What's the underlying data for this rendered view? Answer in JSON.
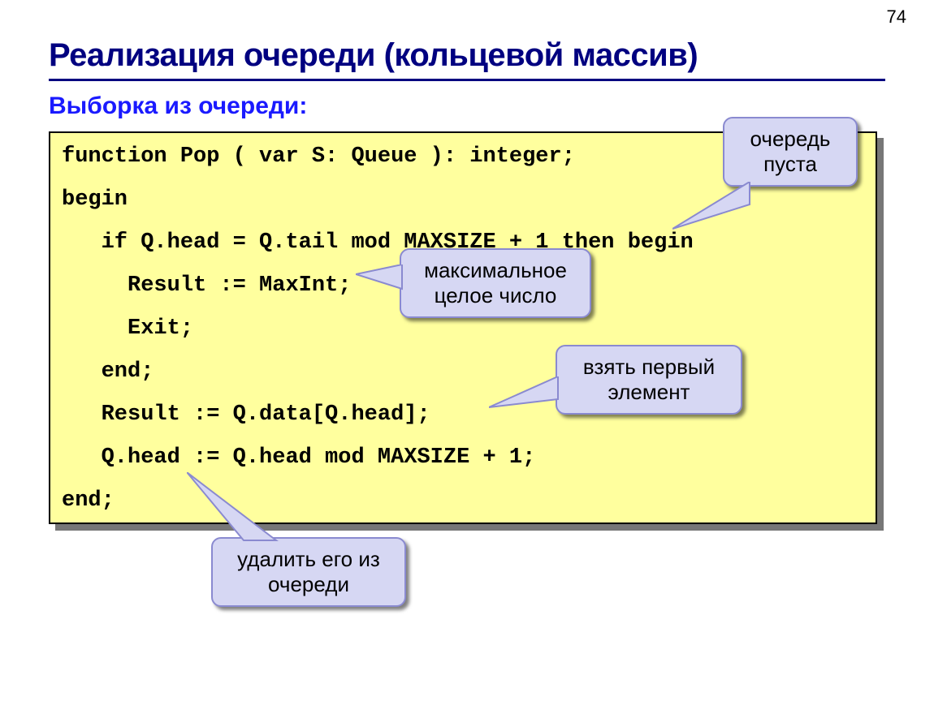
{
  "page_number": "74",
  "title": "Реализация очереди (кольцевой массив)",
  "subtitle": "Выборка из очереди:",
  "code": {
    "l1": "function Pop ( var S: Queue ): integer;",
    "l2": "begin",
    "l3": "   if Q.head = Q.tail mod MAXSIZE + 1 then begin",
    "l4": "     Result := MaxInt;",
    "l5": "     Exit;",
    "l6": "   end;",
    "l7": "   Result := Q.data[Q.head];",
    "l8": "   Q.head := Q.head mod MAXSIZE + 1;",
    "l9": "end;"
  },
  "callouts": {
    "empty_l1": "очередь",
    "empty_l2": "пуста",
    "maxint_l1": "максимальное",
    "maxint_l2": "целое число",
    "first_l1": "взять первый",
    "first_l2": "элемент",
    "delete_l1": "удалить его из",
    "delete_l2": "очереди"
  }
}
